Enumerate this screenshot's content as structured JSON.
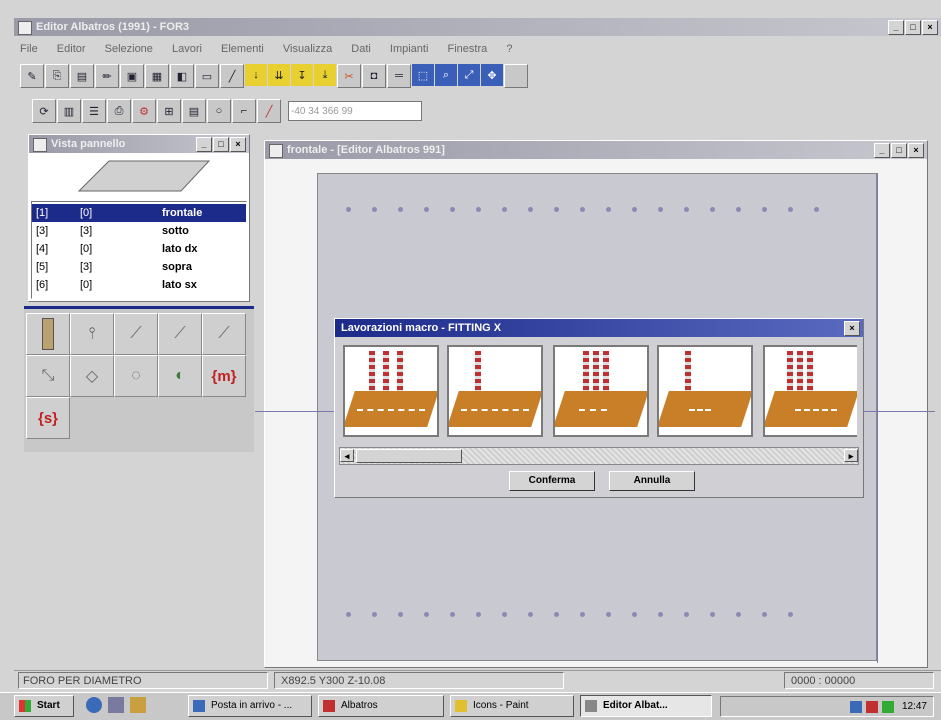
{
  "app": {
    "title": "Editor Albatros (1991) - FOR3"
  },
  "menu": [
    "File",
    "Editor",
    "Selezione",
    "Lavori",
    "Elementi",
    "Visualizza",
    "Dati",
    "Impianti",
    "Finestra",
    "?"
  ],
  "toolbar": {
    "coord_field": "-40 34 366 99"
  },
  "view_panel": {
    "title": "Vista pannello",
    "rows": [
      {
        "id": "[1]",
        "num": "[0]",
        "face": "frontale"
      },
      {
        "id": "[3]",
        "num": "[3]",
        "face": "sotto"
      },
      {
        "id": "[4]",
        "num": "[0]",
        "face": "lato dx"
      },
      {
        "id": "[5]",
        "num": "[3]",
        "face": "sopra"
      },
      {
        "id": "[6]",
        "num": "[0]",
        "face": "lato sx"
      }
    ],
    "tools_labels": {
      "m": "{m}",
      "s": "{s}"
    }
  },
  "doc_window": {
    "title": "frontale - [Editor Albatros 991]"
  },
  "dialog": {
    "title": "Lavorazioni macro - FITTING X",
    "confirm_label": "Conferma",
    "cancel_label": "Annulla"
  },
  "status": {
    "message": "FORO PER DIAMETRO",
    "coords": "X892.5 Y300 Z-10.08",
    "extra": "0000 : 00000"
  },
  "taskbar": {
    "start_label": "Start",
    "items": [
      "Posta in arrivo - ...",
      "Albatros",
      "Icons - Paint",
      "Editor Albat..."
    ],
    "clock": "12:47"
  },
  "colors": {
    "accent": "#1c2a8a",
    "board": "#c97e28",
    "desktop": "#d4d4d4"
  }
}
